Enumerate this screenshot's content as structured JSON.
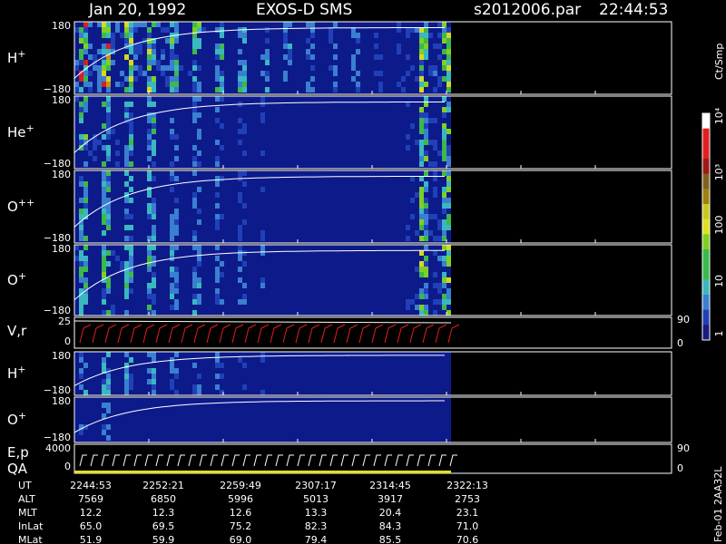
{
  "header": {
    "date": "Jan 20, 1992",
    "instrument": "EXOS-D SMS",
    "file": "s2012006.par",
    "time": "22:44:53"
  },
  "colorbar": {
    "unit": "Ct/Smp",
    "labels": [
      "1",
      "10",
      "100",
      "10³",
      "10⁴"
    ]
  },
  "side_label": "Feb-01 2AA32L",
  "chart_data": {
    "type": "heatmap",
    "panels": [
      {
        "label_base": "H",
        "label_sup": "+",
        "ytop": "180",
        "ybot": "−180",
        "activity": [
          0.9,
          0.75,
          0.55,
          0.45,
          0.35,
          0.3,
          0.2,
          0.7
        ]
      },
      {
        "label_base": "He",
        "label_sup": "+",
        "ytop": "180",
        "ybot": "−180",
        "activity": [
          0.55,
          0.45,
          0.3,
          0.2,
          0.1,
          0.1,
          0.05,
          0.6
        ]
      },
      {
        "label_base": "O",
        "label_sup": "++",
        "ytop": "180",
        "ybot": "−180",
        "activity": [
          0.5,
          0.4,
          0.3,
          0.2,
          0.1,
          0.1,
          0.05,
          0.6
        ]
      },
      {
        "label_base": "O",
        "label_sup": "+",
        "ytop": "180",
        "ybot": "−180",
        "activity": [
          0.55,
          0.45,
          0.35,
          0.3,
          0.15,
          0.1,
          0.05,
          0.7
        ]
      },
      {
        "label_base": "H",
        "label_sup": "+",
        "ytop": "180",
        "ybot": "−180",
        "activity": [
          0.4,
          0.35,
          0.25,
          0.2,
          0.05,
          0.02,
          0.02,
          0.1
        ]
      },
      {
        "label_base": "O",
        "label_sup": "+",
        "ytop": "180",
        "ybot": "−180",
        "activity": [
          0.3,
          0.1,
          0.05,
          0.05,
          0.02,
          0.02,
          0.02,
          0.1
        ]
      }
    ],
    "vr_panel": {
      "label": "V,r",
      "ytop": "25",
      "ybot": "0",
      "rtop": "90",
      "rbot": "0"
    },
    "ep_panel": {
      "label1": "E,p",
      "label2": "QA",
      "ytop": "4000",
      "ybot": "0",
      "rtop": "90",
      "rbot": "0"
    },
    "time_rows": [
      {
        "name": "UT",
        "values": [
          "2244:53",
          "2252:21",
          "2259:49",
          "2307:17",
          "2314:45",
          "2322:13"
        ]
      },
      {
        "name": "ALT",
        "values": [
          "7569",
          "6850",
          "5996",
          "5013",
          "3917",
          "2753"
        ]
      },
      {
        "name": "MLT",
        "values": [
          "12.2",
          "12.3",
          "12.6",
          "13.3",
          "20.4",
          "23.1"
        ]
      },
      {
        "name": "InLat",
        "values": [
          "65.0",
          "69.5",
          "75.2",
          "82.3",
          "84.3",
          "71.0"
        ]
      },
      {
        "name": "MLat",
        "values": [
          "51.9",
          "59.9",
          "69.0",
          "79.4",
          "85.5",
          "70.6"
        ]
      }
    ]
  }
}
